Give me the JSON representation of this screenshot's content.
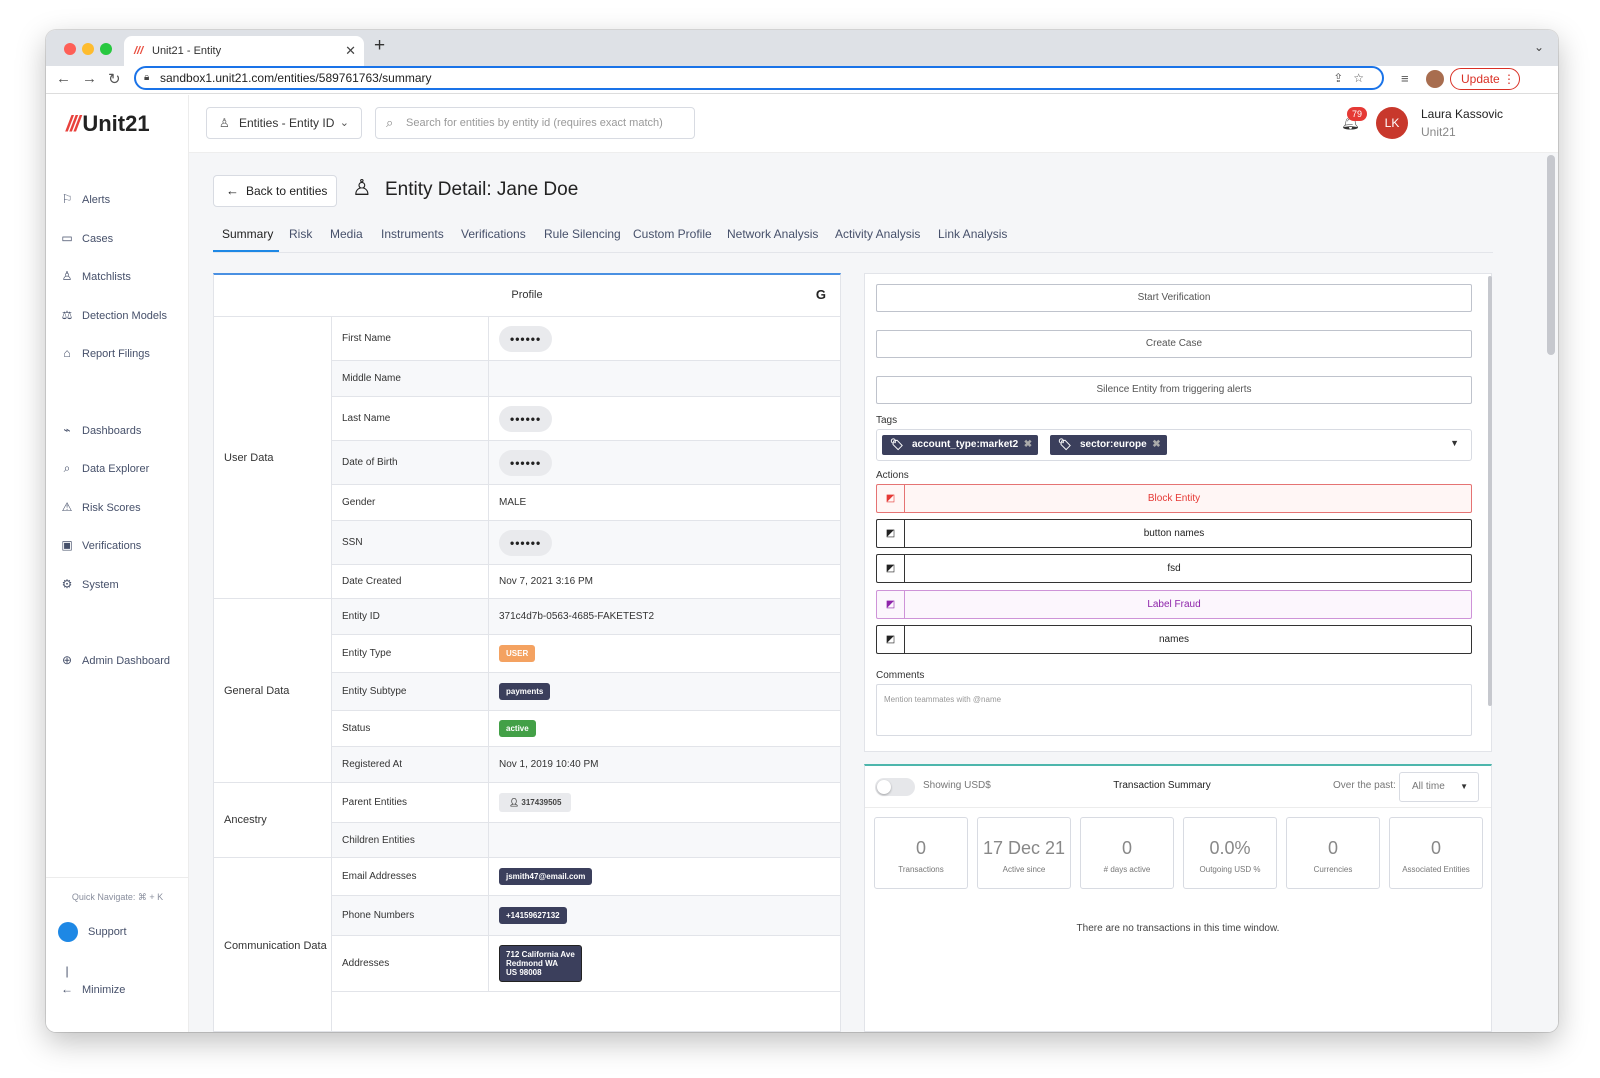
{
  "browser": {
    "tab_title": "Unit21 - Entity",
    "tab_favicon": "///",
    "url": "sandbox1.unit21.com/entities/589761763/summary",
    "update_label": "Update"
  },
  "sidebar": {
    "logo_mark": "///",
    "logo_text": "Unit21",
    "items": [
      {
        "label": "Alerts",
        "icon": "flag-icon"
      },
      {
        "label": "Cases",
        "icon": "briefcase-icon"
      },
      {
        "label": "Matchlists",
        "icon": "user-list-icon"
      },
      {
        "label": "Detection Models",
        "icon": "scale-icon"
      },
      {
        "label": "Report Filings",
        "icon": "bank-icon"
      },
      {
        "label": "Dashboards",
        "icon": "chart-icon"
      },
      {
        "label": "Data Explorer",
        "icon": "data-search-icon"
      },
      {
        "label": "Risk Scores",
        "icon": "warning-icon"
      },
      {
        "label": "Verifications",
        "icon": "id-card-icon"
      },
      {
        "label": "System",
        "icon": "gear-icon"
      },
      {
        "label": "Admin Dashboard",
        "icon": "globe-icon"
      }
    ],
    "quick_navigate": "Quick Navigate: ⌘ + K",
    "support": "Support",
    "minimize": "Minimize"
  },
  "header": {
    "entity_select": "Entities - Entity ID",
    "search_placeholder": "Search for entities by entity id (requires exact match)",
    "notification_count": "79",
    "user_initials": "LK",
    "user_name": "Laura Kassovic",
    "user_org": "Unit21"
  },
  "page": {
    "back_label": "Back to entities",
    "title": "Entity Detail: Jane Doe",
    "tabs": [
      "Summary",
      "Risk",
      "Media",
      "Instruments",
      "Verifications",
      "Rule Silencing",
      "Custom Profile",
      "Network Analysis",
      "Activity Analysis",
      "Link Analysis"
    ],
    "active_tab": "Summary"
  },
  "profile": {
    "title": "Profile",
    "groups": {
      "user_data": "User Data",
      "general_data": "General Data",
      "ancestry": "Ancestry",
      "communication_data": "Communication Data"
    },
    "fields": {
      "first_name": {
        "label": "First Name",
        "value": "••••••"
      },
      "middle_name": {
        "label": "Middle Name",
        "value": ""
      },
      "last_name": {
        "label": "Last Name",
        "value": "••••••"
      },
      "dob": {
        "label": "Date of Birth",
        "value": "••••••"
      },
      "gender": {
        "label": "Gender",
        "value": "MALE"
      },
      "ssn": {
        "label": "SSN",
        "value": "••••••"
      },
      "date_created": {
        "label": "Date Created",
        "value": "Nov 7, 2021 3:16 PM"
      },
      "entity_id": {
        "label": "Entity ID",
        "value": "371c4d7b-0563-4685-FAKETEST2"
      },
      "entity_type": {
        "label": "Entity Type",
        "value": "USER"
      },
      "entity_subtype": {
        "label": "Entity Subtype",
        "value": "payments"
      },
      "status": {
        "label": "Status",
        "value": "active"
      },
      "registered_at": {
        "label": "Registered At",
        "value": "Nov 1, 2019 10:40 PM"
      },
      "parent_entities": {
        "label": "Parent Entities",
        "value": "317439505"
      },
      "children_entities": {
        "label": "Children Entities",
        "value": ""
      },
      "email": {
        "label": "Email Addresses",
        "value": "jsmith47@email.com"
      },
      "phone": {
        "label": "Phone Numbers",
        "value": "+14159627132"
      },
      "addresses": {
        "label": "Addresses",
        "line1": "712 California Ave",
        "line2": "Redmond WA",
        "line3": "US 98008"
      }
    }
  },
  "actions_panel": {
    "start_verification": "Start Verification",
    "create_case": "Create Case",
    "silence": "Silence Entity from triggering alerts",
    "tags_label": "Tags",
    "tags": [
      "account_type:market2",
      "sector:europe"
    ],
    "actions_label": "Actions",
    "actions": [
      {
        "label": "Block Entity",
        "color": "#e53935"
      },
      {
        "label": "button names",
        "color": "#222222"
      },
      {
        "label": "fsd",
        "color": "#222222"
      },
      {
        "label": "Label Fraud",
        "color": "#8e24aa"
      },
      {
        "label": "names",
        "color": "#222222"
      }
    ],
    "comments_label": "Comments",
    "comments_placeholder": "Mention teammates with @name"
  },
  "transactions": {
    "showing": "Showing USD$",
    "title": "Transaction Summary",
    "over_the_past": "Over the past:",
    "period": "All time",
    "stats": [
      {
        "value": "0",
        "label": "Transactions"
      },
      {
        "value": "17 Dec 21",
        "label": "Active since"
      },
      {
        "value": "0",
        "label": "# days active"
      },
      {
        "value": "0.0%",
        "label": "Outgoing USD %"
      },
      {
        "value": "0",
        "label": "Currencies"
      },
      {
        "value": "0",
        "label": "Associated Entities"
      }
    ],
    "empty": "There are no transactions in this time window."
  }
}
